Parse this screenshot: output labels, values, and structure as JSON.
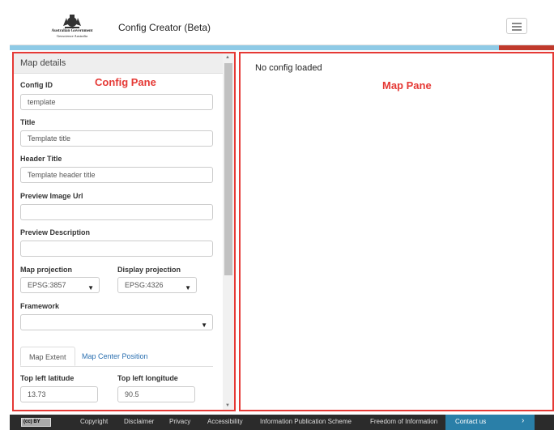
{
  "header": {
    "logo_line1": "Australian Government",
    "logo_line2": "Geoscience Australia",
    "app_title": "Config Creator (Beta)"
  },
  "config_pane": {
    "annotation": "Config Pane",
    "section_title": "Map details",
    "fields": {
      "config_id": {
        "label": "Config ID",
        "value": "template"
      },
      "title": {
        "label": "Title",
        "value": "Template title"
      },
      "header_title": {
        "label": "Header Title",
        "value": "Template header title"
      },
      "preview_image_url": {
        "label": "Preview Image Url",
        "value": ""
      },
      "preview_description": {
        "label": "Preview Description",
        "value": ""
      },
      "map_projection": {
        "label": "Map projection",
        "value": "EPSG:3857"
      },
      "display_projection": {
        "label": "Display projection",
        "value": "EPSG:4326"
      },
      "framework": {
        "label": "Framework",
        "value": ""
      }
    },
    "tabs": [
      {
        "label": "Map Extent",
        "active": true
      },
      {
        "label": "Map Center Position",
        "active": false
      }
    ],
    "extent": {
      "top_left_latitude": {
        "label": "Top left latitude",
        "value": "13.73"
      },
      "top_left_longitude": {
        "label": "Top left longitude",
        "value": "90.5"
      }
    }
  },
  "map_pane": {
    "annotation": "Map Pane",
    "status": "No config loaded"
  },
  "footer": {
    "cc_label": "(cc) BY",
    "links": [
      "Copyright",
      "Disclaimer",
      "Privacy",
      "Accessibility",
      "Information Publication Scheme",
      "Freedom of Information"
    ],
    "contact": "Contact us",
    "contact_arrow": "›"
  },
  "colors": {
    "annotation": "#e53935",
    "accent_blue": "#8ecae6",
    "contact_bg": "#2a7fa8",
    "footer_bg": "#2b2b2b"
  }
}
